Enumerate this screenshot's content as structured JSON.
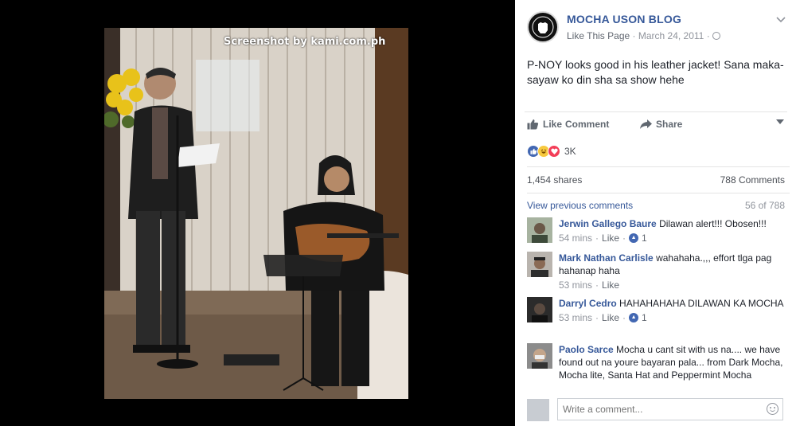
{
  "photo": {
    "watermark": "Screenshot by kami.com.ph"
  },
  "post": {
    "page_name": "MOCHA USON BLOG",
    "like_page": "Like This Page",
    "separator": "·",
    "date": "March 24, 2011",
    "privacy_icon": "globe-icon",
    "menu_icon": "chevron-down-icon",
    "text": "P-NOY looks good in his leather jacket! Sana maka-sayaw ko din sha sa show hehe"
  },
  "actions": {
    "like": "Like",
    "comment": "Comment",
    "share": "Share"
  },
  "reactions": {
    "types": [
      "like",
      "haha",
      "love"
    ],
    "count": "3K"
  },
  "stats": {
    "shares": "1,454 shares",
    "comments": "788 Comments"
  },
  "comments_section": {
    "view_previous": "View previous comments",
    "pager": "56 of 788",
    "items": [
      {
        "author": "Jerwin Gallego Baure",
        "text": "Dilawan alert!!! Obosen!!!",
        "time": "54 mins",
        "like": "Like",
        "reactions": "1",
        "sep": "·"
      },
      {
        "author": "Mark Nathan Carlisle",
        "text": "wahahaha.,,, effort tlga pag hahanap haha",
        "time": "53 mins",
        "like": "Like",
        "reactions": "",
        "sep": "·"
      },
      {
        "author": "Darryl Cedro",
        "text": "HAHAHAHAHA DILAWAN KA MOCHA",
        "time": "53 mins",
        "like": "Like",
        "reactions": "1",
        "sep": "·"
      },
      {
        "author": "Paolo Sarce",
        "text": "Mocha u cant sit with us na.... we have found out na youre bayaran pala... from Dark Mocha, Mocha lite, Santa Hat and Peppermint Mocha",
        "time": "",
        "like": "",
        "reactions": "",
        "sep": ""
      }
    ],
    "write_placeholder": "Write a comment..."
  },
  "colors": {
    "link": "#365899",
    "muted": "#90949c",
    "like_blue": "#4267b2",
    "love_red": "#f33e58",
    "haha_yellow": "#f7c93f"
  }
}
